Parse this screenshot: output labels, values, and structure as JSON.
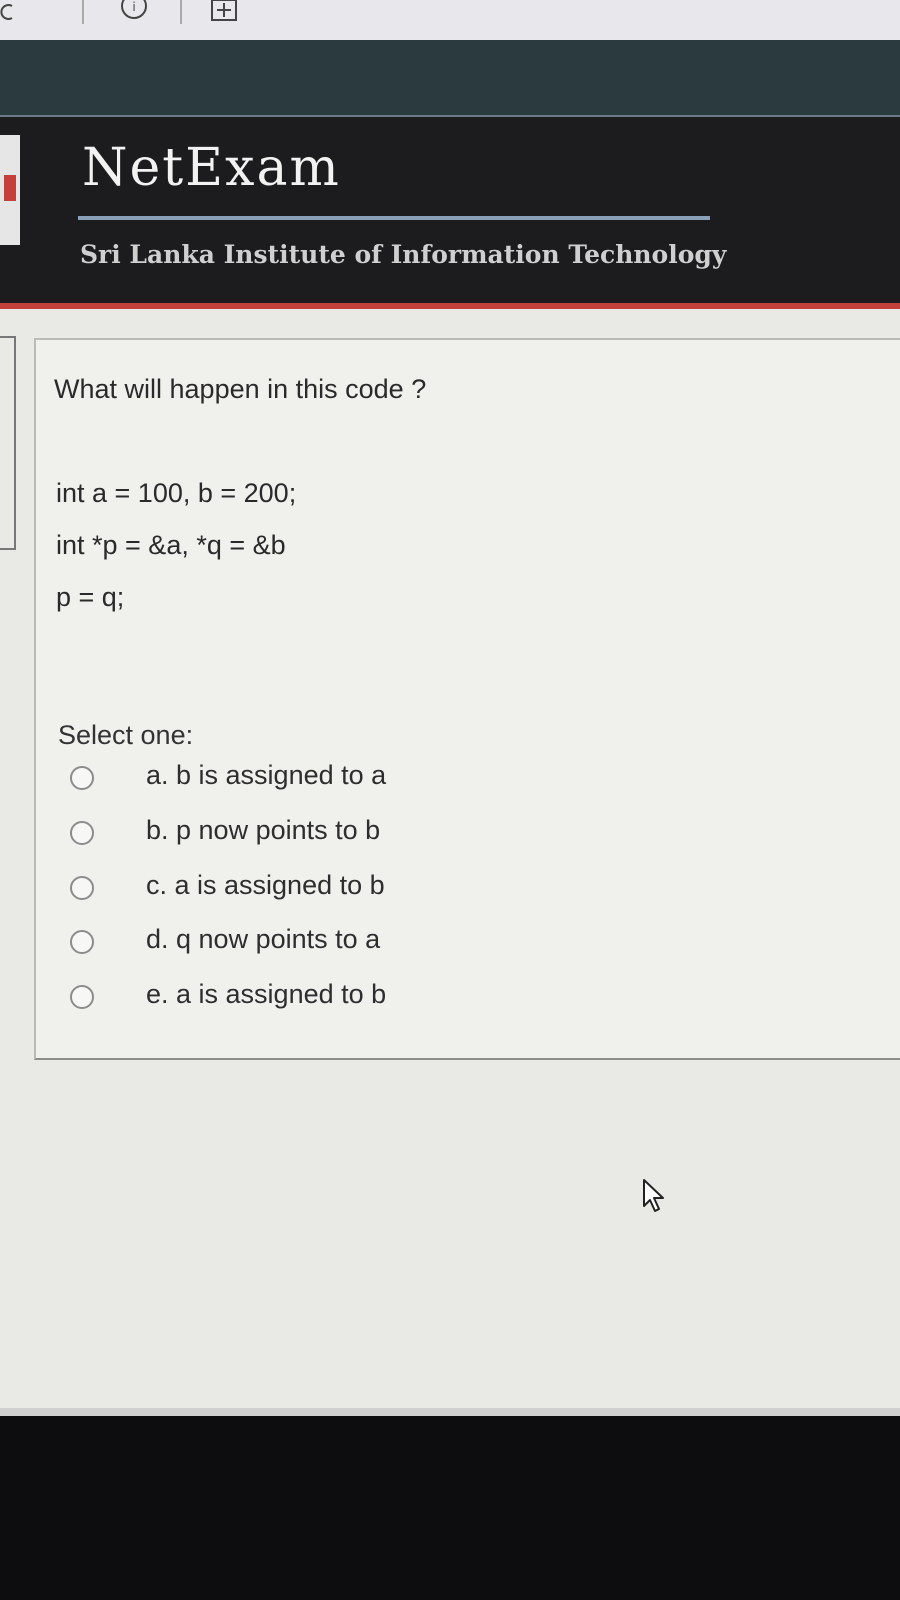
{
  "toolbar": {
    "icons": [
      "refresh-icon",
      "info-icon",
      "new-tab-icon"
    ]
  },
  "header": {
    "logo_text": "NetExam",
    "org_name": "Sri Lanka Institute of Information Technology"
  },
  "question": {
    "text": "What will happen in this code ?",
    "code_lines": [
      "int a = 100, b = 200;",
      "int *p = &a, *q = &b",
      "p = q;"
    ],
    "select_label": "Select one:",
    "options": [
      {
        "label": "a. b is assigned to a",
        "selected": false
      },
      {
        "label": "b. p now points to b",
        "selected": false
      },
      {
        "label": "c. a is assigned to b",
        "selected": false
      },
      {
        "label": "d. q now points to a",
        "selected": false
      },
      {
        "label": "e. a is assigned to b",
        "selected": false
      }
    ]
  },
  "colors": {
    "header_bg": "#1c1c1e",
    "accent_red": "#c4403a",
    "content_bg": "#e9e9e6"
  }
}
